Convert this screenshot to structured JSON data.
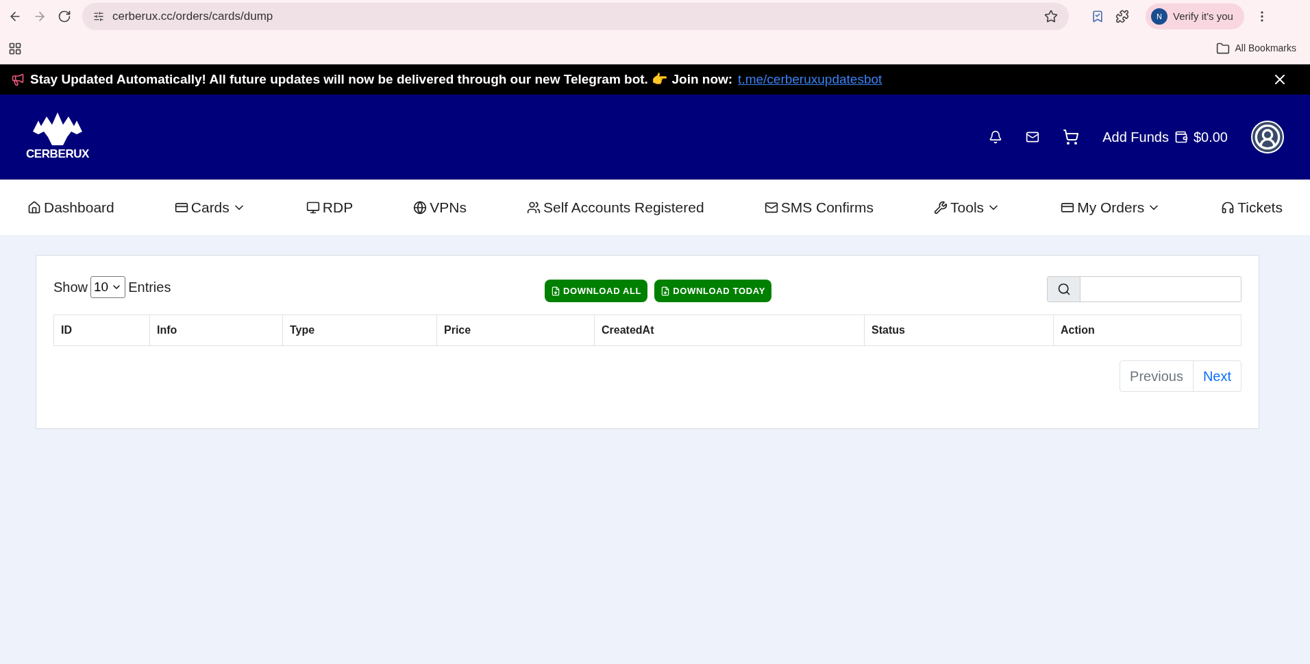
{
  "browser": {
    "url": "cerberux.cc/orders/cards/dump",
    "profile_initial": "N",
    "profile_label": "Verify it's you",
    "bookmarks_folder": "All Bookmarks"
  },
  "announcement": {
    "text": "Stay Updated Automatically! All future updates will now be delivered through our new Telegram bot. 👉 Join now:",
    "link": "t.me/cerberuxupdatesbot"
  },
  "header": {
    "logo_text": "CERBERUX",
    "add_funds": "Add Funds",
    "balance": "$0.00"
  },
  "nav": [
    {
      "label": "Dashboard",
      "dropdown": false
    },
    {
      "label": "Cards",
      "dropdown": true
    },
    {
      "label": "RDP",
      "dropdown": false
    },
    {
      "label": "VPNs",
      "dropdown": false
    },
    {
      "label": "Self Accounts Registered",
      "dropdown": false
    },
    {
      "label": "SMS Confirms",
      "dropdown": false
    },
    {
      "label": "Tools",
      "dropdown": true
    },
    {
      "label": "My Orders",
      "dropdown": true
    },
    {
      "label": "Tickets",
      "dropdown": false
    }
  ],
  "table_controls": {
    "show_label": "Show",
    "entries_value": "10",
    "entries_label": "Entries",
    "buttons": [
      "DOWNLOAD ALL",
      "DOWNLOAD TODAY"
    ]
  },
  "table": {
    "columns": [
      "ID",
      "Info",
      "Type",
      "Price",
      "CreatedAt",
      "Status",
      "Action"
    ]
  },
  "pagination": [
    {
      "label": "Previous",
      "disabled": true
    },
    {
      "label": "Next",
      "disabled": false
    }
  ]
}
